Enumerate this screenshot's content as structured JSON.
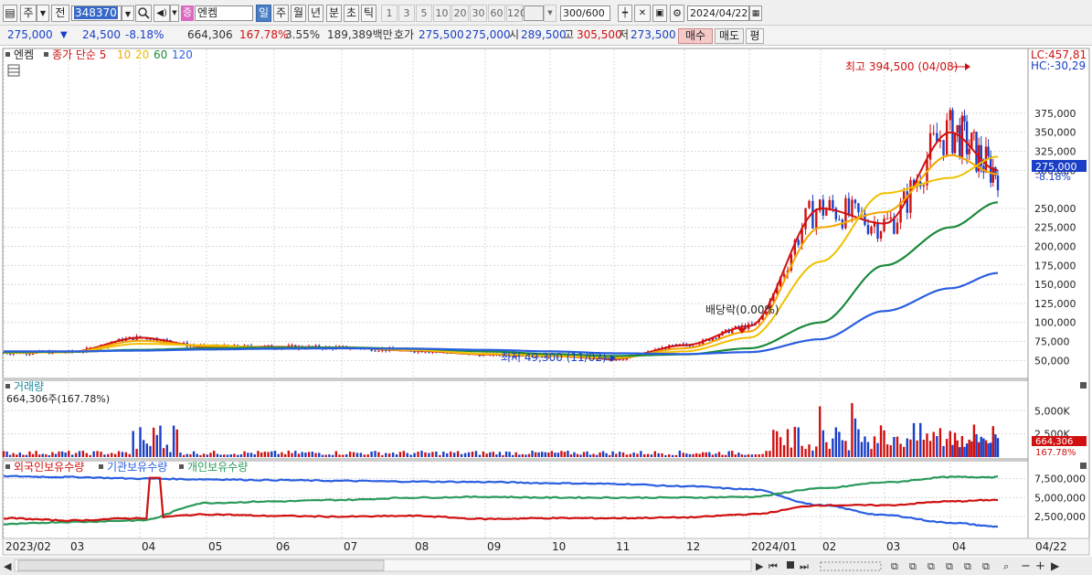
{
  "toolbar": {
    "market": "주",
    "prev_label": "전",
    "stock_code": "348370",
    "stock_badge": "증",
    "stock_name": "엔켐",
    "period_tabs": [
      "일",
      "주",
      "월",
      "년",
      "분",
      "초",
      "틱"
    ],
    "active_period": "일",
    "intervals": [
      "1",
      "3",
      "5",
      "10",
      "20",
      "30",
      "60",
      "120"
    ],
    "count": "300",
    "count_max": "/600",
    "date": "2024/04/22"
  },
  "quote": {
    "price": "275,000",
    "change": "24,500",
    "change_pct": "-8.18%",
    "volume": "664,306",
    "volume_ratio": "167.78%",
    "turnover_pct": "3.55%",
    "amount": "189,389백만",
    "bid_label": "호가",
    "bid": "275,500",
    "ask": "275,000",
    "open_label": "시",
    "open": "289,500",
    "high_label": "고",
    "high": "305,500",
    "low_label": "저",
    "low": "273,500",
    "buy_label": "매수",
    "sell_label": "매도",
    "eval_label": "평"
  },
  "colors": {
    "up": "#d01010",
    "down": "#1a3fc6",
    "ma5": "#d01010",
    "ma10": "#f5a600",
    "ma20": "#f0c000",
    "ma60": "#1c8a3c",
    "ma120": "#2a5ee0",
    "foreign": "#d01010",
    "institution": "#2a5ee0",
    "individual": "#2a9a5a"
  },
  "price_panel": {
    "legend_name": "엔켐",
    "legend_series": [
      "종가 단순 5",
      "10",
      "20",
      "60",
      "120"
    ],
    "lc": "LC:457,81",
    "hc": "HC:-30,29",
    "yticks": [
      "375,000",
      "350,000",
      "325,000",
      "300,000",
      "250,000",
      "225,000",
      "200,000",
      "175,000",
      "150,000",
      "125,000",
      "100,000",
      "75,000",
      "50,000"
    ],
    "current_price_tag": "275,000",
    "current_change_tag": "-8.18%",
    "high_annotation": "최고 394,500 (04/08)",
    "low_annotation": "최저 49,300 (11/02)",
    "dividend_annotation": "배당락(0.00%)"
  },
  "volume_panel": {
    "title": "거래량",
    "value_text": "664,306주(167.78%)",
    "yticks": [
      "5,000K",
      "2,500K"
    ],
    "current_tag": "664,306",
    "current_pct_tag": "167.78%"
  },
  "holdings_panel": {
    "legend": [
      "외국인보유수량",
      "기관보유수량",
      "개인보유수량"
    ],
    "yticks": [
      "7,500,000",
      "5,000,000",
      "2,500,000"
    ]
  },
  "xaxis": [
    "2023/02",
    "03",
    "04",
    "05",
    "06",
    "07",
    "08",
    "09",
    "10",
    "11",
    "12",
    "2024/01",
    "02",
    "03",
    "04"
  ],
  "xaxis_last": "04/22",
  "chart_data": {
    "type": "line",
    "title": "엔켐",
    "xlabel": "",
    "ylabel": "",
    "ylim": [
      30000,
      457810
    ],
    "x": [
      "2023/02",
      "03",
      "04",
      "05",
      "06",
      "07",
      "08",
      "09",
      "10",
      "11",
      "12",
      "2024/01",
      "02",
      "03",
      "04",
      "04/22"
    ],
    "series": [
      {
        "name": "종가 단순 5",
        "values": [
          60000,
          61000,
          80000,
          68000,
          68000,
          67000,
          63000,
          58000,
          56000,
          52000,
          70000,
          95000,
          250000,
          230000,
          350000,
          300000
        ]
      },
      {
        "name": "10",
        "values": [
          60000,
          61000,
          76000,
          69000,
          67500,
          67000,
          63500,
          58500,
          56000,
          53000,
          66000,
          88000,
          225000,
          245000,
          320000,
          295000
        ]
      },
      {
        "name": "20",
        "values": [
          60000,
          61000,
          72000,
          70000,
          67000,
          67000,
          64000,
          59000,
          56500,
          54000,
          62000,
          80000,
          180000,
          270000,
          290000,
          318000
        ]
      },
      {
        "name": "60",
        "values": [
          61000,
          61500,
          64000,
          66000,
          67000,
          67000,
          65500,
          62000,
          58500,
          56000,
          58000,
          66000,
          100000,
          175000,
          225000,
          258000
        ]
      },
      {
        "name": "120",
        "values": [
          62000,
          62000,
          63000,
          64500,
          65500,
          66000,
          65500,
          64000,
          62000,
          59500,
          58500,
          61000,
          78000,
          115000,
          145000,
          165000
        ]
      }
    ],
    "annotations": {
      "high": "394,500 (04/08)",
      "low": "49,300 (11/02)",
      "last_close": "275,000"
    },
    "grid": true,
    "legend": "top-left"
  }
}
